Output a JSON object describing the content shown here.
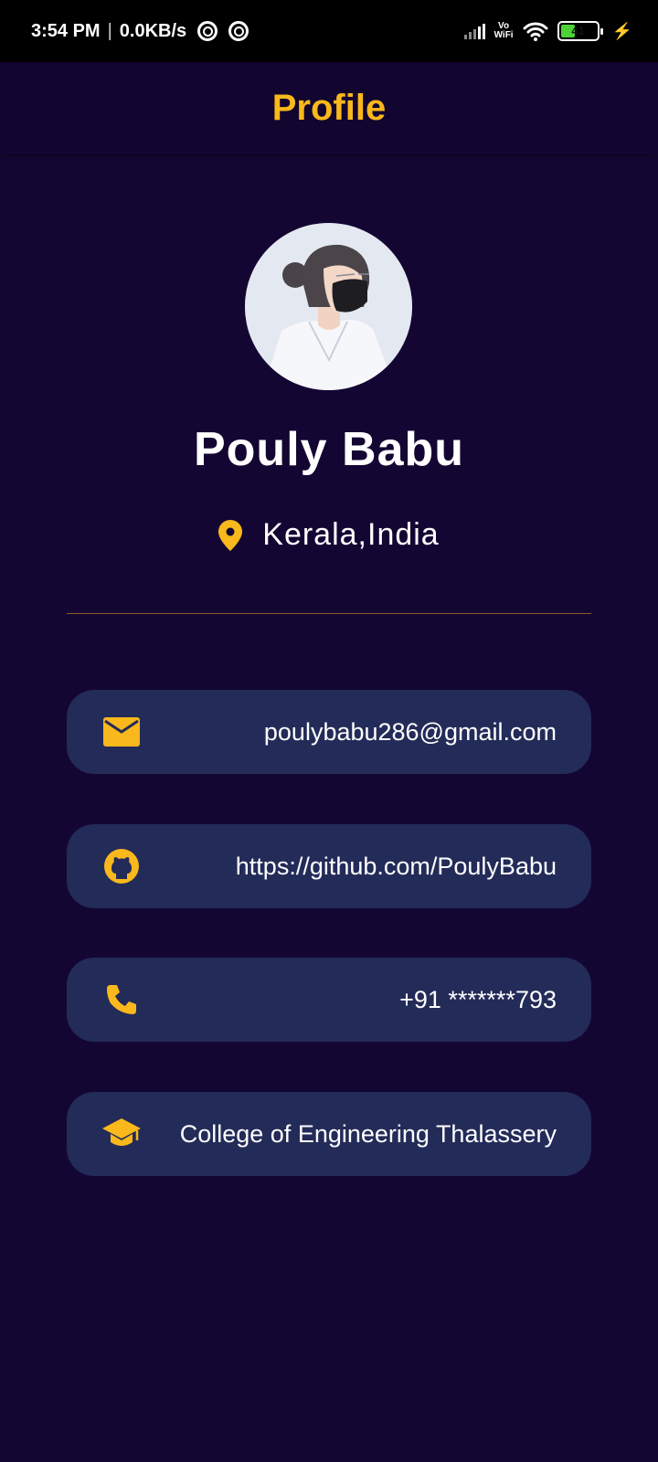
{
  "status_bar": {
    "time": "3:54 PM",
    "separator": "|",
    "speed": "0.0KB/s",
    "vowifi_line1": "Vo",
    "vowifi_line2": "WiFi",
    "battery": "41"
  },
  "app_bar": {
    "title": "Profile"
  },
  "profile": {
    "name": "Pouly Babu",
    "location": "Kerala,India"
  },
  "contacts": {
    "email": "poulybabu286@gmail.com",
    "github": "https://github.com/PoulyBabu",
    "phone": "+91 *******793",
    "college": "College of Engineering Thalassery"
  },
  "colors": {
    "background": "#140633",
    "accent": "#f9b81b",
    "card": "#232b58"
  },
  "icons": {
    "location": "location-pin-icon",
    "email": "mail-icon",
    "github": "github-icon",
    "phone": "phone-icon",
    "college": "graduation-cap-icon"
  }
}
